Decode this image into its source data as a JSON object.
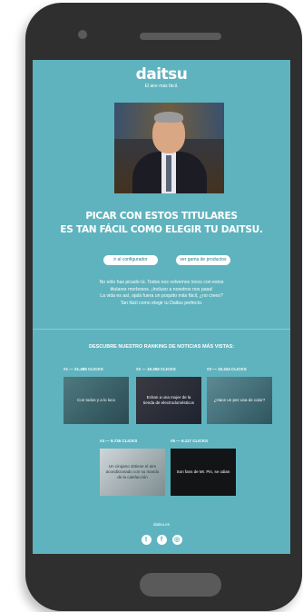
{
  "brand": {
    "logo": "daitsu",
    "tagline": "El aire más fácil."
  },
  "hero": {
    "image_alt": "man-in-suit-smiling"
  },
  "headline": {
    "line1": "PICAR CON ESTOS TITULARES",
    "line2": "ES TAN FÁCIL COMO ELEGIR TU DAITSU."
  },
  "buttons": {
    "configurator": "ir al configurador",
    "range": "ver gama de productos"
  },
  "paragraph": {
    "line1": "No sólo has picado tú. Todos nos volvemos locos con estos",
    "line2": "titulares morbosos. ¡Incluso a nosotros nos pasa!",
    "line3": "La vida es así, ojalá fuera un poquito más fácil, ¿no crees?",
    "line4": "Tan fácil como elegir tu Daitsu perfecto."
  },
  "ranking": {
    "title": "DESCUBRE NUESTRO RANKING DE NOTICIAS MÁS VISTAS:",
    "items": [
      {
        "rank": "#1 — 21.485 CLICKS",
        "caption": "Con todos y a lo loco"
      },
      {
        "rank": "#2 — 19.359 CLICKS",
        "caption": "Echan a una mujer de la tienda de electrodomésticos"
      },
      {
        "rank": "#3 — 15.324 CLICKS",
        "caption": "¿Hace un pez una de calor?"
      },
      {
        "rank": "#4 — 9.735 CLICKS",
        "caption": "Un cirujano obtiene el aire acondicionado con su mando de la calefacción"
      },
      {
        "rank": "#5 — 6.117 CLICKS",
        "caption": "Son fans de Mr. Pin, se odian"
      }
    ]
  },
  "footer": {
    "domain": "daitsu.es",
    "socials": [
      {
        "icon": "twitter-icon",
        "glyph": "t"
      },
      {
        "icon": "facebook-icon",
        "glyph": "f"
      },
      {
        "icon": "instagram-icon",
        "glyph": "◎"
      }
    ]
  },
  "colors": {
    "screen_bg": "#5fb3be",
    "phone": "#2f2f2f"
  }
}
